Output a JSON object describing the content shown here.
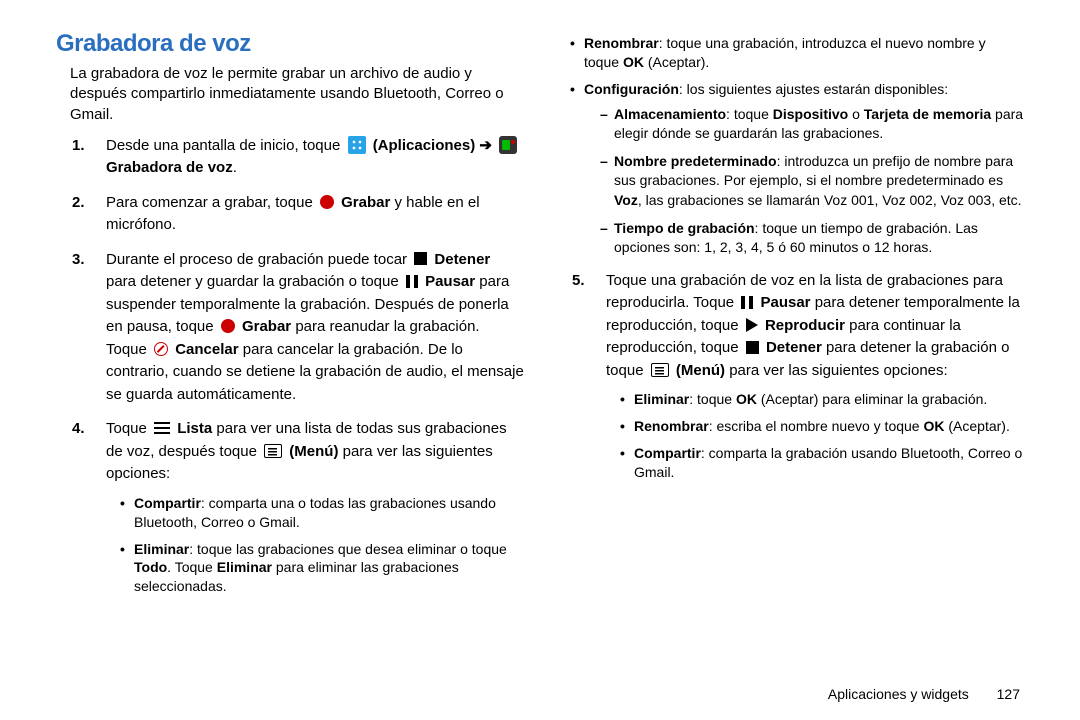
{
  "title": "Grabadora de voz",
  "intro": "La grabadora de voz le permite grabar un archivo de audio y después compartirlo inmediatamente usando Bluetooth, Correo o Gmail.",
  "steps": {
    "s1_a": "Desde una pantalla de inicio, toque",
    "s1_apps": "(Aplicaciones)",
    "s1_arrow": "➔",
    "s1_rec": "Grabadora de voz",
    "s2_a": "Para comenzar a grabar, toque",
    "s2_b": "Grabar",
    "s2_c": "y hable en el micrófono.",
    "s3_a": "Durante el proceso de grabación puede tocar",
    "s3_b": "Detener",
    "s3_c": "para detener y guardar la grabación o toque",
    "s3_d": "Pausar",
    "s3_e": "para suspender temporalmente la grabación. Después de ponerla en pausa, toque",
    "s3_f": "Grabar",
    "s3_g": "para reanudar la grabación. Toque",
    "s3_h": "Cancelar",
    "s3_i": "para cancelar la grabación. De lo contrario, cuando se detiene la grabación de audio, el mensaje se guarda automáticamente.",
    "s4_a": "Toque",
    "s4_b": "Lista",
    "s4_c": "para ver una lista de todas sus grabaciones de voz, después toque",
    "s4_d": "(Menú)",
    "s4_e": "para ver las siguientes opciones:",
    "s4_bullets": {
      "b1_a": "Compartir",
      "b1_b": ": comparta una o todas las grabaciones usando Bluetooth, Correo o Gmail.",
      "b2_a": "Eliminar",
      "b2_b": ": toque las grabaciones que desea eliminar o toque ",
      "b2_c": "Todo",
      "b2_d": ". Toque ",
      "b2_e": "Eliminar",
      "b2_f": " para eliminar las grabaciones seleccionadas.",
      "b3_a": "Renombrar",
      "b3_b": ": toque una grabación, introduzca el nuevo nombre y toque ",
      "b3_c": "OK",
      "b3_d": " (Aceptar).",
      "b4_a": "Configuración",
      "b4_b": ": los siguientes ajustes estarán disponibles:",
      "d1_a": "Almacenamiento",
      "d1_b": ": toque ",
      "d1_c": "Dispositivo",
      "d1_d": " o ",
      "d1_e": "Tarjeta de memoria",
      "d1_f": " para elegir dónde se guardarán las grabaciones.",
      "d2_a": "Nombre predeterminado",
      "d2_b": ": introduzca un prefijo de nombre para sus grabaciones. Por ejemplo, si el nombre predeterminado es ",
      "d2_c": "Voz",
      "d2_d": ", las grabaciones se llamarán Voz 001, Voz 002, Voz 003, etc.",
      "d3_a": "Tiempo de grabación",
      "d3_b": ": toque un tiempo de grabación. Las opciones son: 1, 2, 3, 4, 5 ó 60 minutos o 12 horas."
    },
    "s5_a": "Toque una grabación de voz en la lista de grabaciones para reproducirla. Toque",
    "s5_b": "Pausar",
    "s5_c": "para detener temporalmente la reproducción, toque",
    "s5_d": "Reproducir",
    "s5_e": "para continuar la reproducción, toque",
    "s5_f": "Detener",
    "s5_g": "para detener la grabación o toque",
    "s5_h": "(Menú)",
    "s5_i": "para ver las siguientes opciones:",
    "s5_bullets": {
      "b1_a": "Eliminar",
      "b1_b": ": toque ",
      "b1_c": "OK",
      "b1_d": " (Aceptar) para eliminar la grabación.",
      "b2_a": "Renombrar",
      "b2_b": ": escriba el nombre nuevo y toque ",
      "b2_c": "OK",
      "b2_d": " (Aceptar).",
      "b3_a": "Compartir",
      "b3_b": ": comparta la grabación usando Bluetooth, Correo o Gmail."
    }
  },
  "footer": {
    "section": "Aplicaciones y widgets",
    "page": "127"
  }
}
